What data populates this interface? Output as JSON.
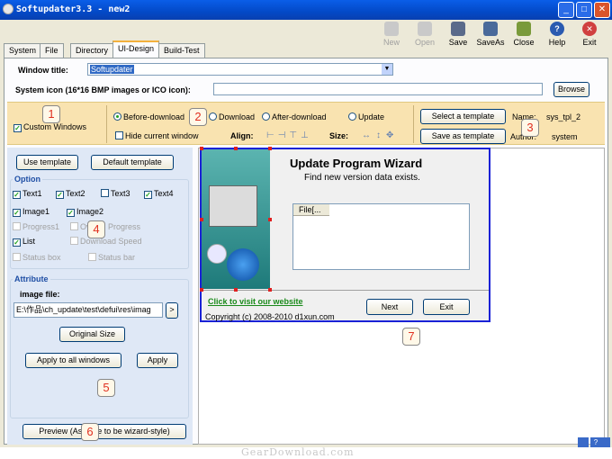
{
  "window": {
    "title": "Softupdater3.3 - new2"
  },
  "toolbar": [
    {
      "label": "New",
      "icon": "new-icon",
      "enabled": false
    },
    {
      "label": "Open",
      "icon": "open-icon",
      "enabled": false
    },
    {
      "label": "Save",
      "icon": "save-icon",
      "enabled": true
    },
    {
      "label": "SaveAs",
      "icon": "saveas-icon",
      "enabled": true
    },
    {
      "label": "Close",
      "icon": "close-project-icon",
      "enabled": true
    },
    {
      "label": "Help",
      "icon": "help-icon",
      "enabled": true
    },
    {
      "label": "Exit",
      "icon": "exit-icon",
      "enabled": true
    }
  ],
  "tabs": [
    "System",
    "File",
    "Directory",
    "UI-Design",
    "Build-Test"
  ],
  "active_tab": "UI-Design",
  "form": {
    "window_title_label": "Window title:",
    "window_title_value": "Softupdater",
    "system_icon_label": "System icon (16*16 BMP images or ICO icon):",
    "system_icon_value": "",
    "browse_label": "Browse"
  },
  "options_bar": {
    "custom_windows": "Custom Windows",
    "radios": [
      "Before-download",
      "Download",
      "After-download",
      "Update"
    ],
    "selected_radio": "Before-download",
    "hide_current_window": "Hide current window",
    "align_label": "Align:",
    "size_label": "Size:",
    "select_template": "Select a template",
    "save_as_template": "Save as template",
    "name_label": "Name:",
    "name_value": "sys_tpl_2",
    "author_label": "Author:",
    "author_value": "system"
  },
  "left_panel": {
    "use_template": "Use template",
    "default_template": "Default template",
    "option_title": "Option",
    "checks": [
      {
        "label": "Text1",
        "checked": true,
        "enabled": true
      },
      {
        "label": "Text2",
        "checked": true,
        "enabled": true
      },
      {
        "label": "Text3",
        "checked": false,
        "enabled": true
      },
      {
        "label": "Text4",
        "checked": true,
        "enabled": true
      },
      {
        "label": "Image1",
        "checked": true,
        "enabled": true
      },
      {
        "label": "Image2",
        "checked": true,
        "enabled": true
      },
      {
        "label": "Progress1",
        "checked": false,
        "enabled": false
      },
      {
        "label": "Overall Progress",
        "checked": false,
        "enabled": false
      },
      {
        "label": "List",
        "checked": true,
        "enabled": true
      },
      {
        "label": "Download Speed",
        "checked": false,
        "enabled": false
      },
      {
        "label": "Status box",
        "checked": false,
        "enabled": false
      },
      {
        "label": "Status bar",
        "checked": false,
        "enabled": false
      }
    ],
    "attribute_title": "Attribute",
    "image_file_label": "image file:",
    "image_file_value": "E:\\作品\\ch_update\\test\\defui\\res\\imag",
    "more_label": ">",
    "original_size": "Original Size",
    "apply_all": "Apply to all windows",
    "apply": "Apply",
    "preview": "Preview (Assume to be wizard-style)"
  },
  "wizard": {
    "title": "Update Program Wizard",
    "subtitle": "Find new version data exists.",
    "list_header": "File[...",
    "link": "Click to visit our website",
    "copyright": "Copyright (c) 2008-2010 d1xun.com",
    "next": "Next",
    "exit": "Exit"
  },
  "annotations": [
    "1",
    "2",
    "3",
    "4",
    "5",
    "6",
    "7"
  ],
  "watermark": "GearDownload.com",
  "colors": {
    "titlebar": "#0349c7",
    "accent": "#f3b03d",
    "wizard_border": "#1a22d6",
    "annotation": "#e03020"
  }
}
